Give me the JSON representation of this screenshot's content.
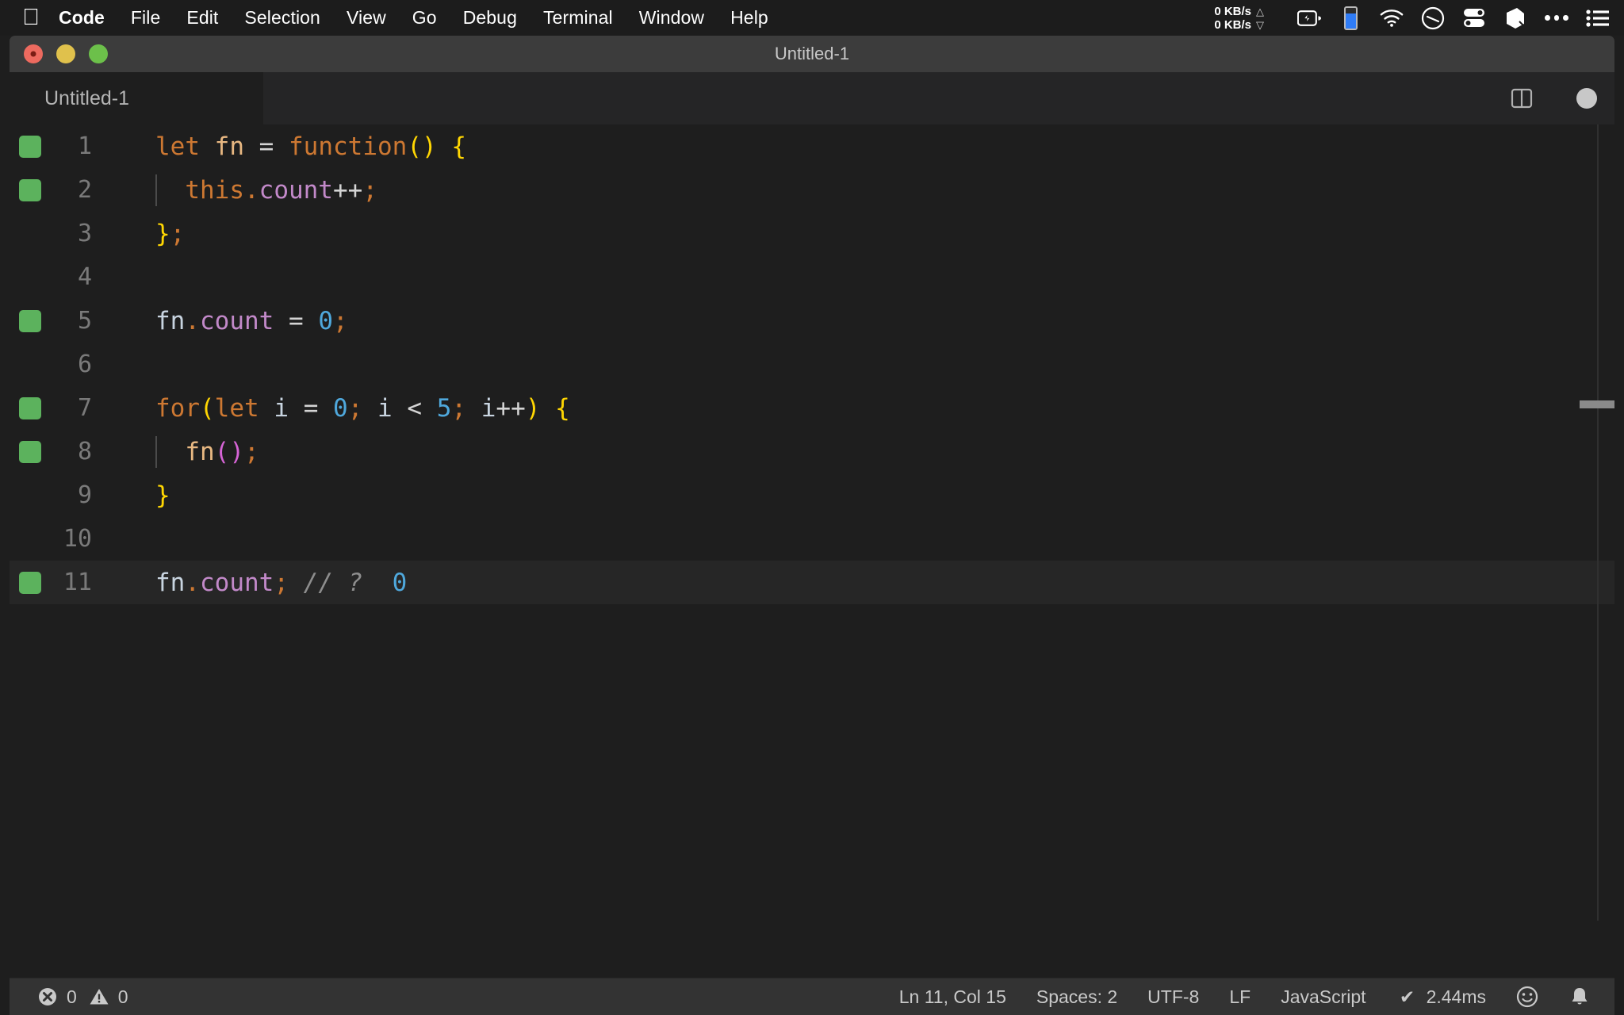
{
  "menubar": {
    "apple_icon": "apple-logo-icon",
    "items": [
      {
        "label": "Code",
        "bold": true
      },
      {
        "label": "File",
        "bold": false
      },
      {
        "label": "Edit",
        "bold": false
      },
      {
        "label": "Selection",
        "bold": false
      },
      {
        "label": "View",
        "bold": false
      },
      {
        "label": "Go",
        "bold": false
      },
      {
        "label": "Debug",
        "bold": false
      },
      {
        "label": "Terminal",
        "bold": false
      },
      {
        "label": "Window",
        "bold": false
      },
      {
        "label": "Help",
        "bold": false
      }
    ],
    "network": {
      "upload": "0 KB/s",
      "download": "0 KB/s",
      "up_arrow": "triangle-up-icon",
      "down_arrow": "triangle-down-icon"
    },
    "tray_icons": [
      "battery-charging-icon",
      "battery-level-indicator-icon",
      "wifi-icon",
      "speedometer-icon",
      "control-center-icon",
      "cube-icon",
      "ellipsis-icon",
      "list-menu-icon"
    ],
    "battery_fill_color": "#2f7cf6"
  },
  "window": {
    "title": "Untitled-1",
    "traffic_lights": [
      "close",
      "minimize",
      "zoom"
    ]
  },
  "tabbar": {
    "active_tab": "Untitled-1",
    "split_editor_icon": "split-editor-icon",
    "dirty_indicator": "unsaved-dot-icon"
  },
  "editor": {
    "language_accent": "#4fa8dc",
    "active_line": 11,
    "lines": [
      {
        "number": "1",
        "marker": true,
        "indent_guide": false,
        "tokens": [
          {
            "t": "let",
            "c": "t-key"
          },
          {
            "t": " ",
            "c": "t-white"
          },
          {
            "t": "fn",
            "c": "t-fn"
          },
          {
            "t": " ",
            "c": "t-white"
          },
          {
            "t": "=",
            "c": "t-op"
          },
          {
            "t": " ",
            "c": "t-white"
          },
          {
            "t": "function",
            "c": "t-key"
          },
          {
            "t": "()",
            "c": "t-brk-y"
          },
          {
            "t": " ",
            "c": "t-white"
          },
          {
            "t": "{",
            "c": "t-brk-y"
          }
        ]
      },
      {
        "number": "2",
        "marker": true,
        "indent_guide": true,
        "tokens": [
          {
            "t": "  ",
            "c": "t-white"
          },
          {
            "t": "this",
            "c": "t-key"
          },
          {
            "t": ".",
            "c": "t-punc"
          },
          {
            "t": "count",
            "c": "t-prop"
          },
          {
            "t": "++",
            "c": "t-op"
          },
          {
            "t": ";",
            "c": "t-punc"
          }
        ]
      },
      {
        "number": "3",
        "marker": false,
        "indent_guide": false,
        "tokens": [
          {
            "t": "}",
            "c": "t-brk-y"
          },
          {
            "t": ";",
            "c": "t-punc"
          }
        ]
      },
      {
        "number": "4",
        "marker": false,
        "indent_guide": false,
        "tokens": []
      },
      {
        "number": "5",
        "marker": true,
        "indent_guide": false,
        "tokens": [
          {
            "t": "fn",
            "c": "t-ident"
          },
          {
            "t": ".",
            "c": "t-punc"
          },
          {
            "t": "count",
            "c": "t-prop"
          },
          {
            "t": " ",
            "c": "t-white"
          },
          {
            "t": "=",
            "c": "t-op"
          },
          {
            "t": " ",
            "c": "t-white"
          },
          {
            "t": "0",
            "c": "t-num"
          },
          {
            "t": ";",
            "c": "t-punc"
          }
        ]
      },
      {
        "number": "6",
        "marker": false,
        "indent_guide": false,
        "tokens": []
      },
      {
        "number": "7",
        "marker": true,
        "indent_guide": false,
        "tokens": [
          {
            "t": "for",
            "c": "t-key"
          },
          {
            "t": "(",
            "c": "t-brk-y"
          },
          {
            "t": "let",
            "c": "t-key"
          },
          {
            "t": " ",
            "c": "t-white"
          },
          {
            "t": "i",
            "c": "t-ident"
          },
          {
            "t": " ",
            "c": "t-white"
          },
          {
            "t": "=",
            "c": "t-op"
          },
          {
            "t": " ",
            "c": "t-white"
          },
          {
            "t": "0",
            "c": "t-num"
          },
          {
            "t": ";",
            "c": "t-punc"
          },
          {
            "t": " ",
            "c": "t-white"
          },
          {
            "t": "i",
            "c": "t-ident"
          },
          {
            "t": " ",
            "c": "t-white"
          },
          {
            "t": "<",
            "c": "t-op"
          },
          {
            "t": " ",
            "c": "t-white"
          },
          {
            "t": "5",
            "c": "t-num"
          },
          {
            "t": ";",
            "c": "t-punc"
          },
          {
            "t": " ",
            "c": "t-white"
          },
          {
            "t": "i",
            "c": "t-ident"
          },
          {
            "t": "++",
            "c": "t-op"
          },
          {
            "t": ")",
            "c": "t-brk-y"
          },
          {
            "t": " ",
            "c": "t-white"
          },
          {
            "t": "{",
            "c": "t-brk-y"
          }
        ]
      },
      {
        "number": "8",
        "marker": true,
        "indent_guide": true,
        "tokens": [
          {
            "t": "  ",
            "c": "t-white"
          },
          {
            "t": "fn",
            "c": "t-fn"
          },
          {
            "t": "()",
            "c": "t-brk-m"
          },
          {
            "t": ";",
            "c": "t-punc"
          }
        ]
      },
      {
        "number": "9",
        "marker": false,
        "indent_guide": false,
        "tokens": [
          {
            "t": "}",
            "c": "t-brk-y"
          }
        ]
      },
      {
        "number": "10",
        "marker": false,
        "indent_guide": false,
        "tokens": []
      },
      {
        "number": "11",
        "marker": true,
        "indent_guide": false,
        "active": true,
        "tokens": [
          {
            "t": "fn",
            "c": "t-ident"
          },
          {
            "t": ".",
            "c": "t-punc"
          },
          {
            "t": "count",
            "c": "t-prop"
          },
          {
            "t": ";",
            "c": "t-punc"
          },
          {
            "t": " ",
            "c": "t-white"
          },
          {
            "t": "// ?",
            "c": "t-comment"
          },
          {
            "t": "  ",
            "c": "t-white"
          },
          {
            "t": "0",
            "c": "t-num"
          }
        ]
      }
    ]
  },
  "statusbar": {
    "error_icon": "error-circle-icon",
    "error_count": "0",
    "warning_icon": "warning-triangle-icon",
    "warning_count": "0",
    "cursor_position": "Ln 11, Col 15",
    "indentation": "Spaces: 2",
    "encoding": "UTF-8",
    "eol": "LF",
    "language": "JavaScript",
    "runtime_check_icon": "checkmark-icon",
    "runtime_time": "2.44ms",
    "feedback_icon": "smiley-icon",
    "notifications_icon": "bell-icon"
  }
}
